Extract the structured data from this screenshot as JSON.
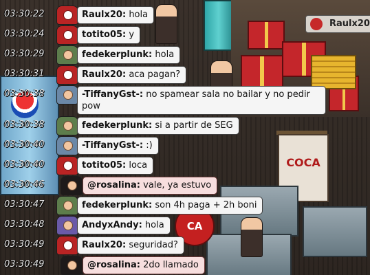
{
  "scene": {
    "banner_text": "COCA",
    "sign_text": "CA",
    "corner_chat": "Raulx20"
  },
  "chat": [
    {
      "time": "03:30:22",
      "name": "Raulx20:",
      "text": "hola",
      "avatar": "red-santa-avatar"
    },
    {
      "time": "03:30:24",
      "name": "totito05:",
      "text": "y",
      "avatar": "red-santa-avatar"
    },
    {
      "time": "03:30:29",
      "name": "fedekerplunk:",
      "text": "hola",
      "avatar": "green-avatar"
    },
    {
      "time": "03:30:31",
      "name": "Raulx20:",
      "text": "aca pagan?",
      "avatar": "red-santa-avatar"
    },
    {
      "time": "03:30:38",
      "name": "-TiffanyGst-:",
      "text": "no spamear sala no bailar y no pedir pow",
      "avatar": "blue-avatar"
    },
    {
      "time": "03:30:38",
      "name": "fedekerplunk:",
      "text": "si a partir de SEG",
      "avatar": "green-avatar"
    },
    {
      "time": "03:30:40",
      "name": "-TiffanyGst-:",
      "text": ":)",
      "avatar": "blue-avatar"
    },
    {
      "time": "03:30:40",
      "name": "totito05:",
      "text": "loca",
      "avatar": "red-santa-avatar"
    },
    {
      "time": "03:30:46",
      "name": "@rosalina:",
      "text": "vale, ya estuvo",
      "avatar": "black-avatar"
    },
    {
      "time": "03:30:47",
      "name": "fedekerplunk:",
      "text": "son 4h paga + 2h boni",
      "avatar": "green-avatar"
    },
    {
      "time": "03:30:48",
      "name": "AndyxAndy:",
      "text": "hola",
      "avatar": "purple-avatar"
    },
    {
      "time": "03:30:49",
      "name": "Raulx20:",
      "text": "seguridad?",
      "avatar": "red-santa-avatar"
    },
    {
      "time": "03:30:49",
      "name": "@rosalina:",
      "text": "2do llamado",
      "avatar": "black-avatar"
    }
  ]
}
